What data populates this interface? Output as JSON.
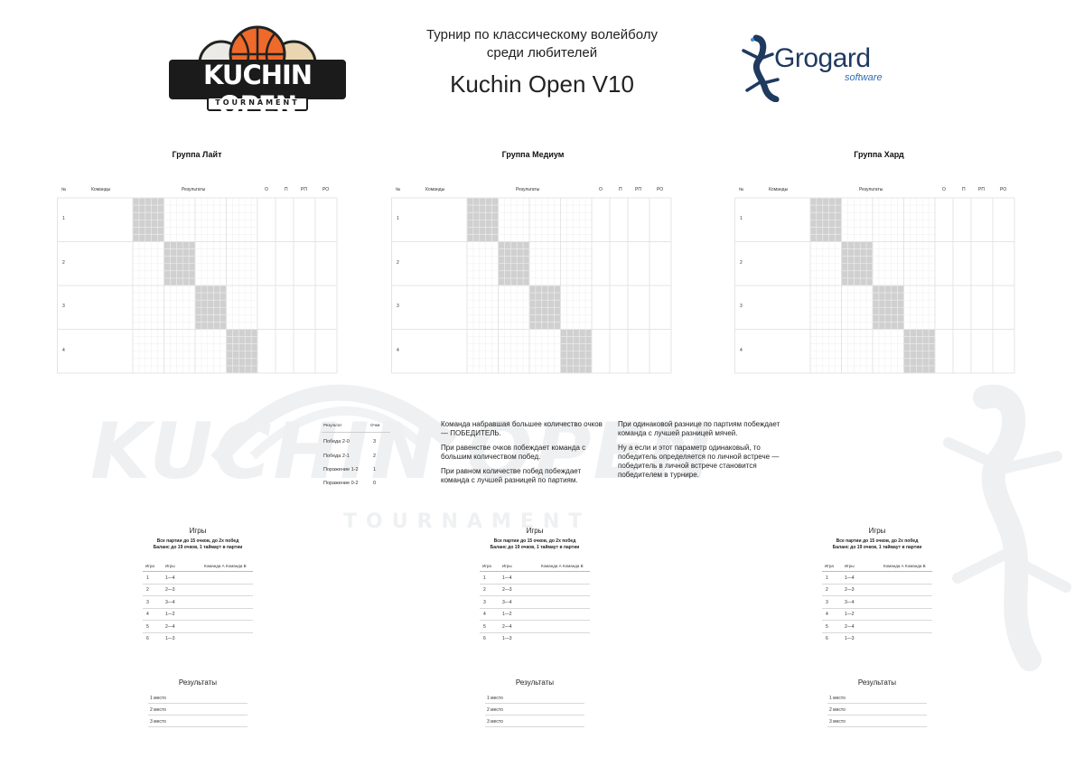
{
  "header": {
    "subtitle_line1": "Турнир по классическому волейболу",
    "subtitle_line2": "среди любителей",
    "title": "Kuchin Open V10",
    "logo_left_main": "KUCHIN OPEN",
    "logo_left_sub": "TOURNAMENT",
    "logo_right_main": "Grogard",
    "logo_right_sub": "software"
  },
  "groups": [
    {
      "title": "Группа Лайт"
    },
    {
      "title": "Группа Медиум"
    },
    {
      "title": "Группа Хард"
    }
  ],
  "table_headers": {
    "num": "№",
    "teams": "Команды",
    "results": "Результаты",
    "o": "О",
    "p": "П",
    "rp": "РП",
    "ro": "РО"
  },
  "row_numbers": [
    "1",
    "2",
    "3",
    "4"
  ],
  "points": {
    "header_result": "Результат",
    "header_points": "Очки",
    "rows": [
      {
        "result": "Победа 2-0",
        "points": "3"
      },
      {
        "result": "Победа 2-1",
        "points": "2"
      },
      {
        "result": "Поражение 1-2",
        "points": "1"
      },
      {
        "result": "Поражение 0-2",
        "points": "0"
      }
    ]
  },
  "rules_left": [
    "Команда набравшая большее количество очков — ПОБЕДИТЕЛЬ.",
    "При равенстве очков побеждает команда с большим количеством побед.",
    "При равном количестве побед побеждает команда с лучшей разницей по партиям."
  ],
  "rules_right": [
    "При одинаковой разнице по партиям побеждает команда с лучшей разницей мячей.",
    "Ну а если и этот параметр одинаковый, то победитель определяется по личной встрече — победитель в личной встрече становится победителем в турнире."
  ],
  "games": {
    "title": "Игры",
    "sub1": "Все партии до 15 очков, до 2х побед",
    "sub2": "Баланс до 19 очков, 1 таймаут в партии",
    "headers": {
      "game": "Игра",
      "games": "Игры",
      "team_a": "Команда А",
      "team_b": "Команда В"
    },
    "rows": [
      {
        "n": "1",
        "pair": "1—4"
      },
      {
        "n": "2",
        "pair": "2—3"
      },
      {
        "n": "3",
        "pair": "3—4"
      },
      {
        "n": "4",
        "pair": "1—2"
      },
      {
        "n": "5",
        "pair": "2—4"
      },
      {
        "n": "6",
        "pair": "1—3"
      }
    ]
  },
  "results": {
    "title": "Результаты",
    "places": [
      "1 место",
      "2 место",
      "3 место"
    ]
  },
  "colors": {
    "diag": "#d0d0d0",
    "grid": "#e4e4e4",
    "watermark": "#eef0f2",
    "accent_orange": "#ee6a2b",
    "logo_navy": "#1f3a5f"
  }
}
